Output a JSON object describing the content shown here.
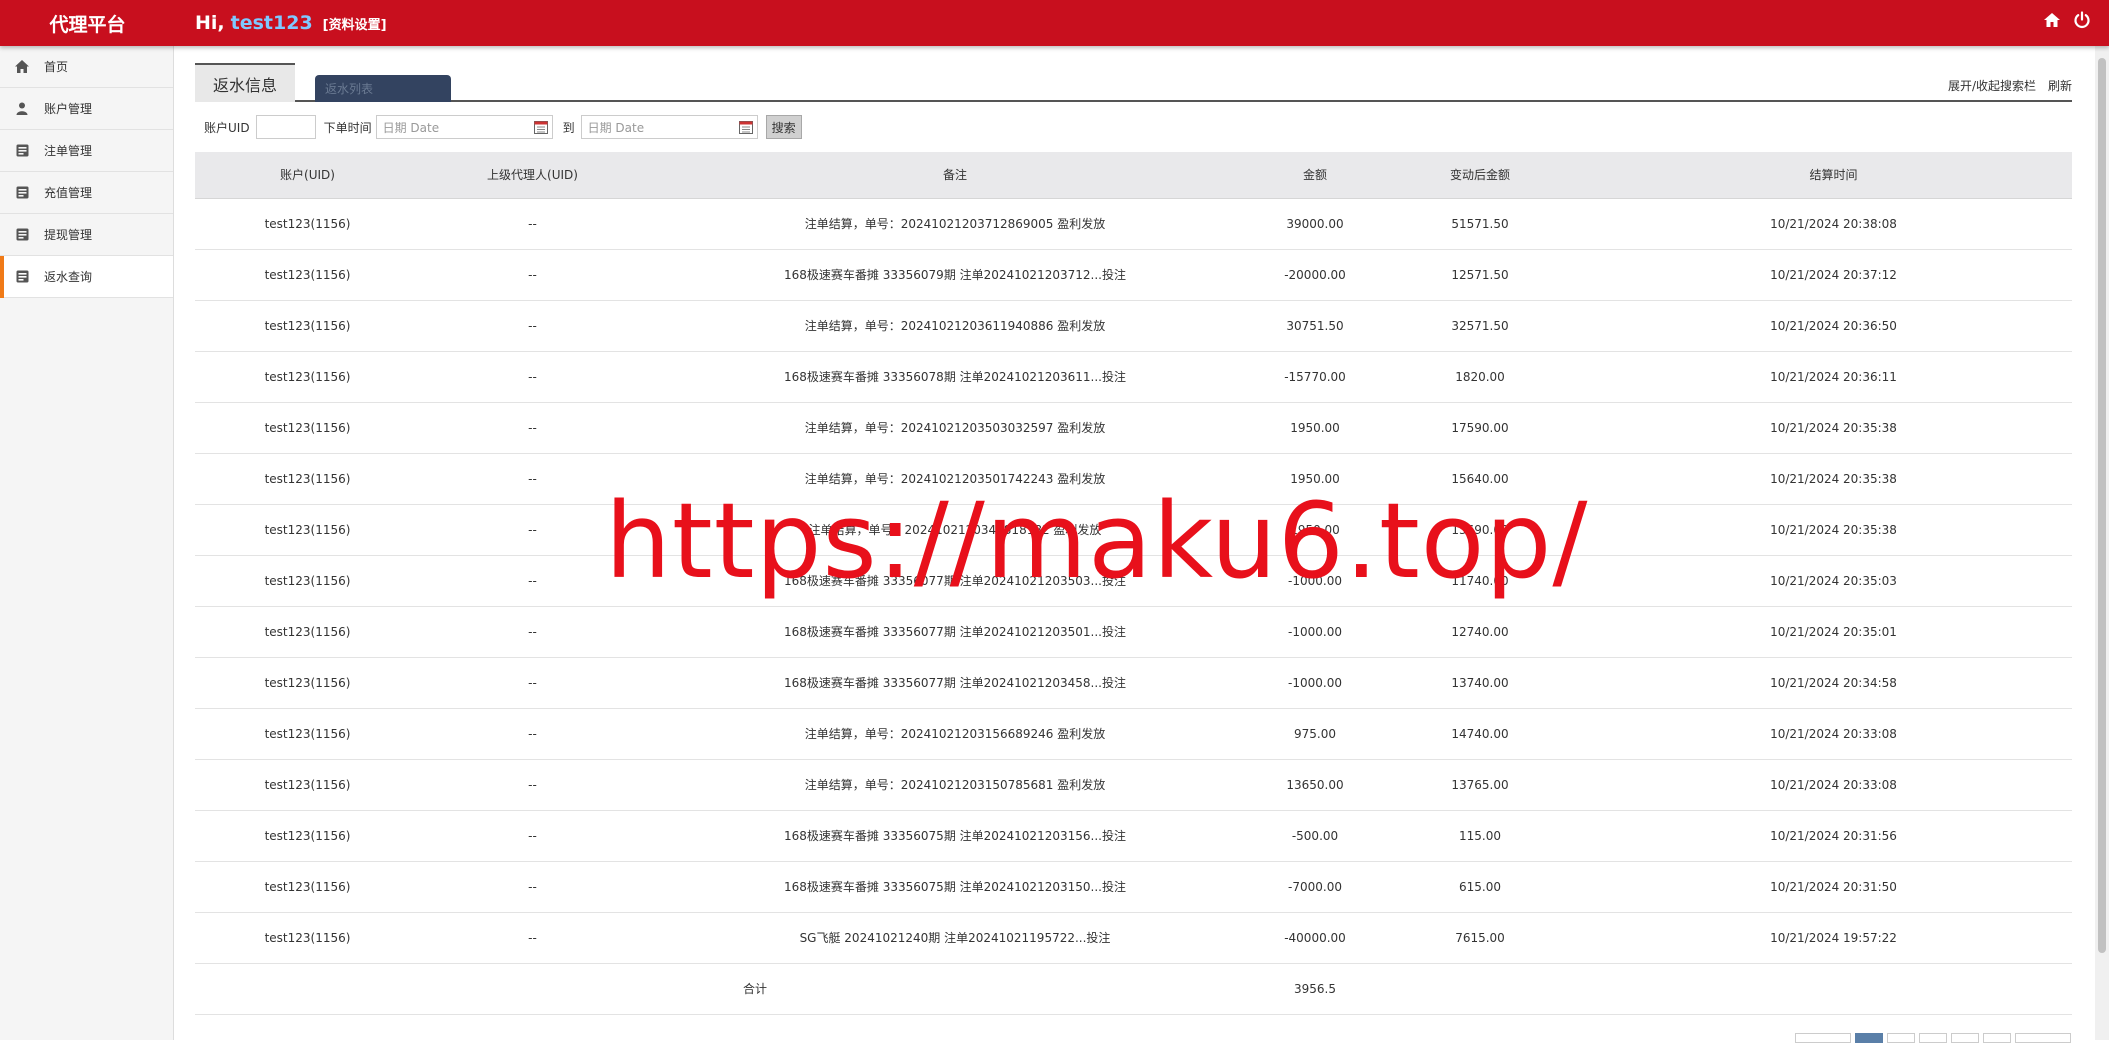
{
  "header": {
    "brand": "代理平台",
    "greeting": "Hi,",
    "username": "test123",
    "profile_link": "[资料设置]",
    "icons": [
      "home-icon",
      "power-icon"
    ]
  },
  "sidebar": {
    "items": [
      {
        "label": "首页",
        "icon": "home-icon"
      },
      {
        "label": "账户管理",
        "icon": "user-icon"
      },
      {
        "label": "注单管理",
        "icon": "list-icon"
      },
      {
        "label": "充值管理",
        "icon": "list-icon"
      },
      {
        "label": "提现管理",
        "icon": "list-icon"
      },
      {
        "label": "返水查询",
        "icon": "list-icon",
        "active": true
      }
    ]
  },
  "tabs": {
    "active": "返水信息",
    "second": "返水列表",
    "toggle_search": "展开/收起搜索栏",
    "refresh": "刷新"
  },
  "search": {
    "uid_label": "账户UID",
    "time_label": "下单时间",
    "date_placeholder": "日期 Date",
    "to_label": "到",
    "button": "搜索"
  },
  "table": {
    "headers": [
      "账户(UID)",
      "上级代理人(UID)",
      "备注",
      "金额",
      "变动后金额",
      "结算时间"
    ],
    "rows": [
      [
        "test123(1156)",
        "--",
        "注单结算，单号：20241021203712869005 盈利发放",
        "39000.00",
        "51571.50",
        "10/21/2024 20:38:08"
      ],
      [
        "test123(1156)",
        "--",
        "168极速赛车番摊 33356079期 注单20241021203712...投注",
        "-20000.00",
        "12571.50",
        "10/21/2024 20:37:12"
      ],
      [
        "test123(1156)",
        "--",
        "注单结算，单号：20241021203611940886 盈利发放",
        "30751.50",
        "32571.50",
        "10/21/2024 20:36:50"
      ],
      [
        "test123(1156)",
        "--",
        "168极速赛车番摊 33356078期 注单20241021203611...投注",
        "-15770.00",
        "1820.00",
        "10/21/2024 20:36:11"
      ],
      [
        "test123(1156)",
        "--",
        "注单结算，单号：20241021203503032597 盈利发放",
        "1950.00",
        "17590.00",
        "10/21/2024 20:35:38"
      ],
      [
        "test123(1156)",
        "--",
        "注单结算，单号：20241021203501742243 盈利发放",
        "1950.00",
        "15640.00",
        "10/21/2024 20:35:38"
      ],
      [
        "test123(1156)",
        "--",
        "注单结算，单号：2024102120345818182 盈利发放",
        "1950.00",
        "13690.00",
        "10/21/2024 20:35:38"
      ],
      [
        "test123(1156)",
        "--",
        "168极速赛车番摊 33356077期 注单20241021203503...投注",
        "-1000.00",
        "11740.00",
        "10/21/2024 20:35:03"
      ],
      [
        "test123(1156)",
        "--",
        "168极速赛车番摊 33356077期 注单20241021203501...投注",
        "-1000.00",
        "12740.00",
        "10/21/2024 20:35:01"
      ],
      [
        "test123(1156)",
        "--",
        "168极速赛车番摊 33356077期 注单20241021203458...投注",
        "-1000.00",
        "13740.00",
        "10/21/2024 20:34:58"
      ],
      [
        "test123(1156)",
        "--",
        "注单结算，单号：20241021203156689246 盈利发放",
        "975.00",
        "14740.00",
        "10/21/2024 20:33:08"
      ],
      [
        "test123(1156)",
        "--",
        "注单结算，单号：20241021203150785681 盈利发放",
        "13650.00",
        "13765.00",
        "10/21/2024 20:33:08"
      ],
      [
        "test123(1156)",
        "--",
        "168极速赛车番摊 33356075期 注单20241021203156...投注",
        "-500.00",
        "115.00",
        "10/21/2024 20:31:56"
      ],
      [
        "test123(1156)",
        "--",
        "168极速赛车番摊 33356075期 注单20241021203150...投注",
        "-7000.00",
        "615.00",
        "10/21/2024 20:31:50"
      ],
      [
        "test123(1156)",
        "--",
        "SG飞艇 20241021240期 注单20241021195722...投注",
        "-40000.00",
        "7615.00",
        "10/21/2024 19:57:22"
      ]
    ],
    "total_label": "合计",
    "total_value": "3956.5"
  },
  "watermark": "https://maku6.top/",
  "colors": {
    "header": "#c80f1e",
    "accent": "#f07a17",
    "tab_dark": "#334360",
    "watermark": "#e8101b"
  }
}
